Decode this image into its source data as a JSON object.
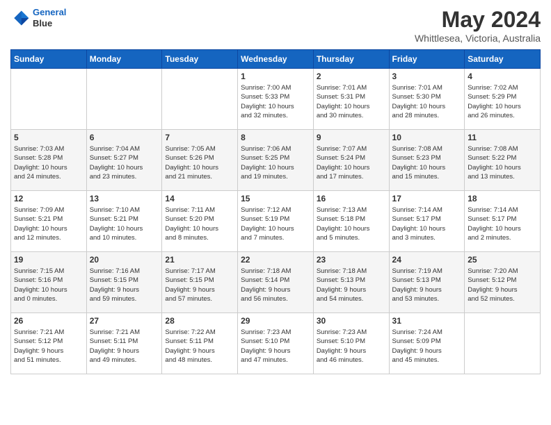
{
  "header": {
    "logo_line1": "General",
    "logo_line2": "Blue",
    "month": "May 2024",
    "location": "Whittlesea, Victoria, Australia"
  },
  "weekdays": [
    "Sunday",
    "Monday",
    "Tuesday",
    "Wednesday",
    "Thursday",
    "Friday",
    "Saturday"
  ],
  "weeks": [
    [
      {
        "day": "",
        "info": ""
      },
      {
        "day": "",
        "info": ""
      },
      {
        "day": "",
        "info": ""
      },
      {
        "day": "1",
        "info": "Sunrise: 7:00 AM\nSunset: 5:33 PM\nDaylight: 10 hours\nand 32 minutes."
      },
      {
        "day": "2",
        "info": "Sunrise: 7:01 AM\nSunset: 5:31 PM\nDaylight: 10 hours\nand 30 minutes."
      },
      {
        "day": "3",
        "info": "Sunrise: 7:01 AM\nSunset: 5:30 PM\nDaylight: 10 hours\nand 28 minutes."
      },
      {
        "day": "4",
        "info": "Sunrise: 7:02 AM\nSunset: 5:29 PM\nDaylight: 10 hours\nand 26 minutes."
      }
    ],
    [
      {
        "day": "5",
        "info": "Sunrise: 7:03 AM\nSunset: 5:28 PM\nDaylight: 10 hours\nand 24 minutes."
      },
      {
        "day": "6",
        "info": "Sunrise: 7:04 AM\nSunset: 5:27 PM\nDaylight: 10 hours\nand 23 minutes."
      },
      {
        "day": "7",
        "info": "Sunrise: 7:05 AM\nSunset: 5:26 PM\nDaylight: 10 hours\nand 21 minutes."
      },
      {
        "day": "8",
        "info": "Sunrise: 7:06 AM\nSunset: 5:25 PM\nDaylight: 10 hours\nand 19 minutes."
      },
      {
        "day": "9",
        "info": "Sunrise: 7:07 AM\nSunset: 5:24 PM\nDaylight: 10 hours\nand 17 minutes."
      },
      {
        "day": "10",
        "info": "Sunrise: 7:08 AM\nSunset: 5:23 PM\nDaylight: 10 hours\nand 15 minutes."
      },
      {
        "day": "11",
        "info": "Sunrise: 7:08 AM\nSunset: 5:22 PM\nDaylight: 10 hours\nand 13 minutes."
      }
    ],
    [
      {
        "day": "12",
        "info": "Sunrise: 7:09 AM\nSunset: 5:21 PM\nDaylight: 10 hours\nand 12 minutes."
      },
      {
        "day": "13",
        "info": "Sunrise: 7:10 AM\nSunset: 5:21 PM\nDaylight: 10 hours\nand 10 minutes."
      },
      {
        "day": "14",
        "info": "Sunrise: 7:11 AM\nSunset: 5:20 PM\nDaylight: 10 hours\nand 8 minutes."
      },
      {
        "day": "15",
        "info": "Sunrise: 7:12 AM\nSunset: 5:19 PM\nDaylight: 10 hours\nand 7 minutes."
      },
      {
        "day": "16",
        "info": "Sunrise: 7:13 AM\nSunset: 5:18 PM\nDaylight: 10 hours\nand 5 minutes."
      },
      {
        "day": "17",
        "info": "Sunrise: 7:14 AM\nSunset: 5:17 PM\nDaylight: 10 hours\nand 3 minutes."
      },
      {
        "day": "18",
        "info": "Sunrise: 7:14 AM\nSunset: 5:17 PM\nDaylight: 10 hours\nand 2 minutes."
      }
    ],
    [
      {
        "day": "19",
        "info": "Sunrise: 7:15 AM\nSunset: 5:16 PM\nDaylight: 10 hours\nand 0 minutes."
      },
      {
        "day": "20",
        "info": "Sunrise: 7:16 AM\nSunset: 5:15 PM\nDaylight: 9 hours\nand 59 minutes."
      },
      {
        "day": "21",
        "info": "Sunrise: 7:17 AM\nSunset: 5:15 PM\nDaylight: 9 hours\nand 57 minutes."
      },
      {
        "day": "22",
        "info": "Sunrise: 7:18 AM\nSunset: 5:14 PM\nDaylight: 9 hours\nand 56 minutes."
      },
      {
        "day": "23",
        "info": "Sunrise: 7:18 AM\nSunset: 5:13 PM\nDaylight: 9 hours\nand 54 minutes."
      },
      {
        "day": "24",
        "info": "Sunrise: 7:19 AM\nSunset: 5:13 PM\nDaylight: 9 hours\nand 53 minutes."
      },
      {
        "day": "25",
        "info": "Sunrise: 7:20 AM\nSunset: 5:12 PM\nDaylight: 9 hours\nand 52 minutes."
      }
    ],
    [
      {
        "day": "26",
        "info": "Sunrise: 7:21 AM\nSunset: 5:12 PM\nDaylight: 9 hours\nand 51 minutes."
      },
      {
        "day": "27",
        "info": "Sunrise: 7:21 AM\nSunset: 5:11 PM\nDaylight: 9 hours\nand 49 minutes."
      },
      {
        "day": "28",
        "info": "Sunrise: 7:22 AM\nSunset: 5:11 PM\nDaylight: 9 hours\nand 48 minutes."
      },
      {
        "day": "29",
        "info": "Sunrise: 7:23 AM\nSunset: 5:10 PM\nDaylight: 9 hours\nand 47 minutes."
      },
      {
        "day": "30",
        "info": "Sunrise: 7:23 AM\nSunset: 5:10 PM\nDaylight: 9 hours\nand 46 minutes."
      },
      {
        "day": "31",
        "info": "Sunrise: 7:24 AM\nSunset: 5:09 PM\nDaylight: 9 hours\nand 45 minutes."
      },
      {
        "day": "",
        "info": ""
      }
    ]
  ]
}
